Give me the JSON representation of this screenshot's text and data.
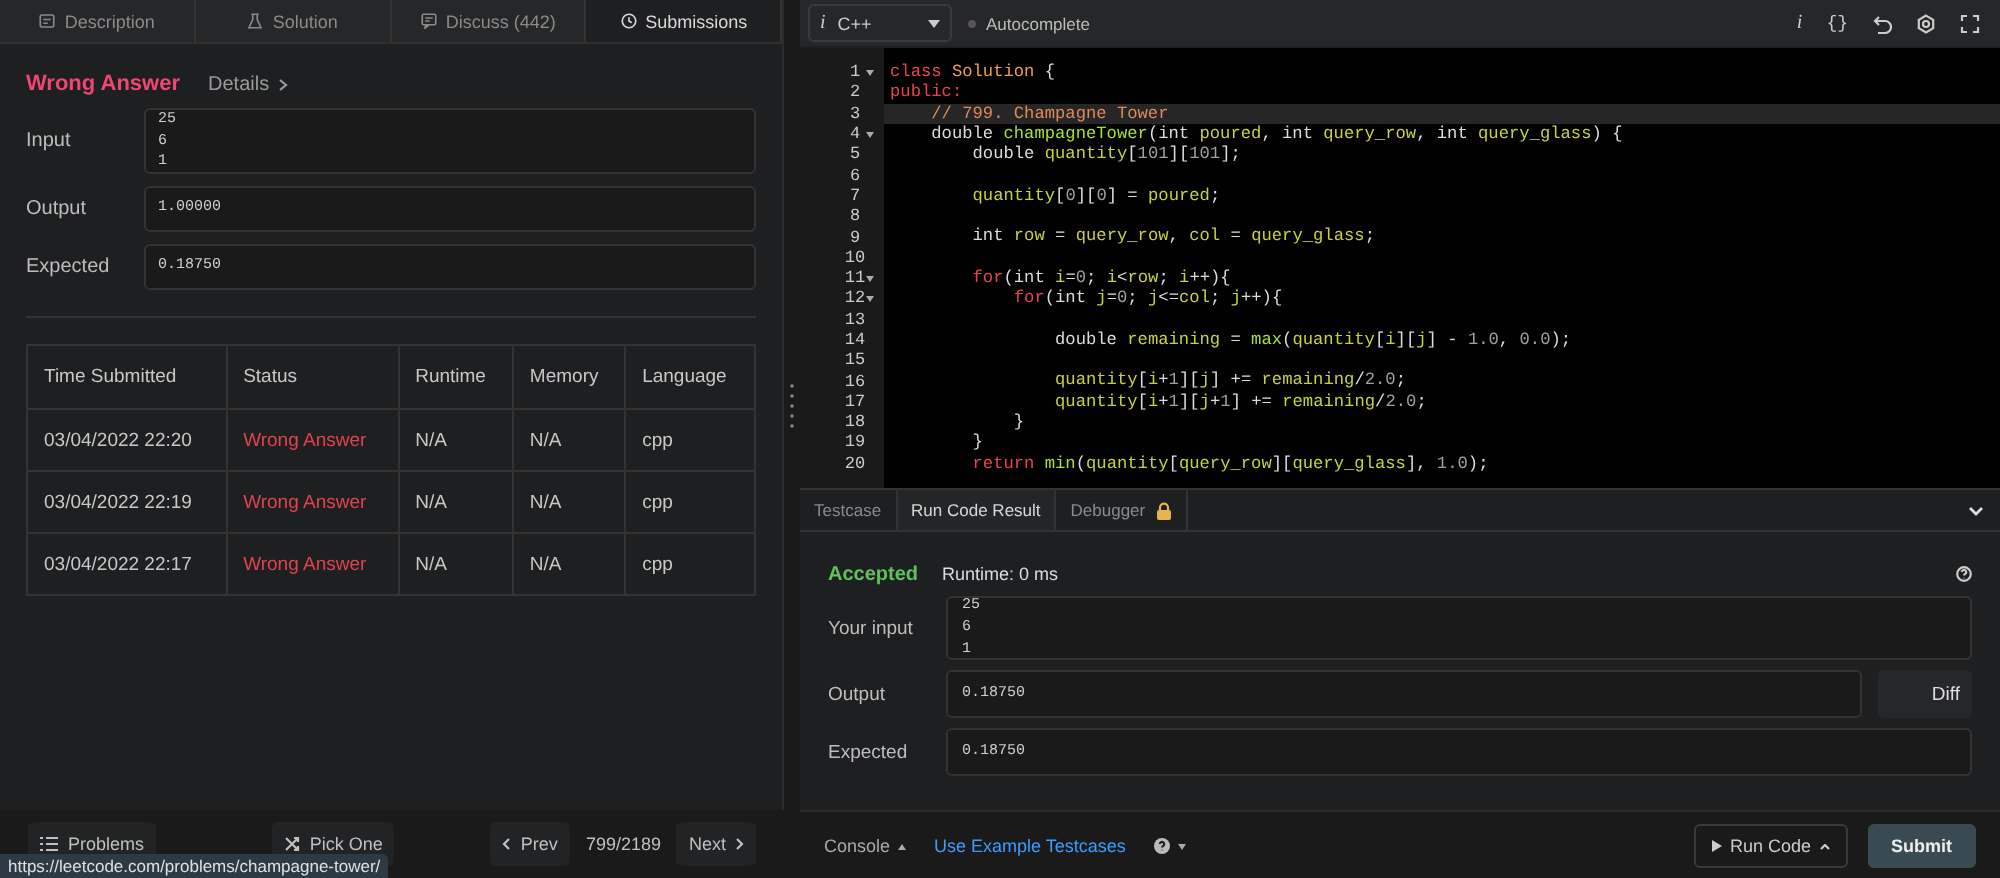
{
  "left_tabs": [
    {
      "label": "Description",
      "selected": false
    },
    {
      "label": "Solution",
      "selected": false
    },
    {
      "label": "Discuss (442)",
      "selected": false
    },
    {
      "label": "Submissions",
      "selected": true
    }
  ],
  "result": {
    "status": "Wrong Answer",
    "details": "Details",
    "fields": [
      {
        "label": "Input",
        "lines": [
          "25",
          "6",
          "1"
        ]
      },
      {
        "label": "Output",
        "lines": [
          "1.00000"
        ]
      },
      {
        "label": "Expected",
        "lines": [
          "0.18750"
        ]
      }
    ]
  },
  "submissions": {
    "columns": [
      "Time Submitted",
      "Status",
      "Runtime",
      "Memory",
      "Language"
    ],
    "rows": [
      {
        "time": "03/04/2022 22:20",
        "status": "Wrong Answer",
        "runtime": "N/A",
        "memory": "N/A",
        "language": "cpp"
      },
      {
        "time": "03/04/2022 22:19",
        "status": "Wrong Answer",
        "runtime": "N/A",
        "memory": "N/A",
        "language": "cpp"
      },
      {
        "time": "03/04/2022 22:17",
        "status": "Wrong Answer",
        "runtime": "N/A",
        "memory": "N/A",
        "language": "cpp"
      }
    ]
  },
  "editor": {
    "info": "i",
    "language": "C++",
    "autocomplete": "Autocomplete",
    "info_button": "i",
    "format": "{}",
    "lines": [
      {
        "number": "1",
        "fold": true,
        "current": false,
        "tokens": [
          {
            "text": "class ",
            "kind": "kw"
          },
          {
            "text": "Solution",
            "kind": "cls"
          },
          {
            "text": " {",
            "kind": "p"
          }
        ]
      },
      {
        "number": "2",
        "fold": false,
        "current": false,
        "tokens": [
          {
            "text": "public:",
            "kind": "kw"
          }
        ]
      },
      {
        "number": "3",
        "fold": false,
        "current": true,
        "tokens": [
          {
            "text": "    // 799. Champagne Tower",
            "kind": "cm"
          }
        ]
      },
      {
        "number": "4",
        "fold": true,
        "current": false,
        "tokens": [
          {
            "text": "    double ",
            "kind": "p"
          },
          {
            "text": "champagneTower",
            "kind": "fn"
          },
          {
            "text": "(int ",
            "kind": "p"
          },
          {
            "text": "poured",
            "kind": "v"
          },
          {
            "text": ", int ",
            "kind": "p"
          },
          {
            "text": "query_row",
            "kind": "v"
          },
          {
            "text": ", int ",
            "kind": "p"
          },
          {
            "text": "query_glass",
            "kind": "v"
          },
          {
            "text": ") {",
            "kind": "p"
          }
        ]
      },
      {
        "number": "5",
        "fold": false,
        "current": false,
        "tokens": [
          {
            "text": "        double ",
            "kind": "p"
          },
          {
            "text": "quantity",
            "kind": "v"
          },
          {
            "text": "[",
            "kind": "p"
          },
          {
            "text": "101",
            "kind": "n"
          },
          {
            "text": "][",
            "kind": "p"
          },
          {
            "text": "101",
            "kind": "n"
          },
          {
            "text": "];",
            "kind": "p"
          }
        ]
      },
      {
        "number": "6",
        "fold": false,
        "current": false
      },
      {
        "number": "7",
        "fold": false,
        "current": false,
        "tokens": [
          {
            "text": "        quantity",
            "kind": "v"
          },
          {
            "text": "[",
            "kind": "p"
          },
          {
            "text": "0",
            "kind": "n"
          },
          {
            "text": "][",
            "kind": "p"
          },
          {
            "text": "0",
            "kind": "n"
          },
          {
            "text": "] = ",
            "kind": "p"
          },
          {
            "text": "poured",
            "kind": "v"
          },
          {
            "text": ";",
            "kind": "p"
          }
        ]
      },
      {
        "number": "8",
        "fold": false,
        "current": false
      },
      {
        "number": "9",
        "fold": false,
        "current": false,
        "tokens": [
          {
            "text": "        int ",
            "kind": "p"
          },
          {
            "text": "row",
            "kind": "v"
          },
          {
            "text": " = ",
            "kind": "p"
          },
          {
            "text": "query_row",
            "kind": "v"
          },
          {
            "text": ", ",
            "kind": "p"
          },
          {
            "text": "col",
            "kind": "v"
          },
          {
            "text": " = ",
            "kind": "p"
          },
          {
            "text": "query_glass",
            "kind": "v"
          },
          {
            "text": ";",
            "kind": "p"
          }
        ]
      },
      {
        "number": "10",
        "fold": false,
        "current": false
      },
      {
        "number": "11",
        "fold": true,
        "current": false,
        "tokens": [
          {
            "text": "        for",
            "kind": "kw"
          },
          {
            "text": "(int ",
            "kind": "p"
          },
          {
            "text": "i",
            "kind": "v"
          },
          {
            "text": "=",
            "kind": "p"
          },
          {
            "text": "0",
            "kind": "n"
          },
          {
            "text": "; ",
            "kind": "p"
          },
          {
            "text": "i",
            "kind": "v"
          },
          {
            "text": "<",
            "kind": "p"
          },
          {
            "text": "row",
            "kind": "v"
          },
          {
            "text": "; ",
            "kind": "p"
          },
          {
            "text": "i",
            "kind": "v"
          },
          {
            "text": "++){",
            "kind": "p"
          }
        ]
      },
      {
        "number": "12",
        "fold": true,
        "current": false,
        "tokens": [
          {
            "text": "            for",
            "kind": "kw"
          },
          {
            "text": "(int ",
            "kind": "p"
          },
          {
            "text": "j",
            "kind": "v"
          },
          {
            "text": "=",
            "kind": "p"
          },
          {
            "text": "0",
            "kind": "n"
          },
          {
            "text": "; ",
            "kind": "p"
          },
          {
            "text": "j",
            "kind": "v"
          },
          {
            "text": "<=",
            "kind": "p"
          },
          {
            "text": "col",
            "kind": "v"
          },
          {
            "text": "; ",
            "kind": "p"
          },
          {
            "text": "j",
            "kind": "v"
          },
          {
            "text": "++){",
            "kind": "p"
          }
        ]
      },
      {
        "number": "13",
        "fold": false,
        "current": false
      },
      {
        "number": "14",
        "fold": false,
        "current": false,
        "tokens": [
          {
            "text": "                double ",
            "kind": "p"
          },
          {
            "text": "remaining",
            "kind": "v"
          },
          {
            "text": " = ",
            "kind": "p"
          },
          {
            "text": "max",
            "kind": "fn"
          },
          {
            "text": "(",
            "kind": "p"
          },
          {
            "text": "quantity",
            "kind": "v"
          },
          {
            "text": "[",
            "kind": "p"
          },
          {
            "text": "i",
            "kind": "v"
          },
          {
            "text": "][",
            "kind": "p"
          },
          {
            "text": "j",
            "kind": "v"
          },
          {
            "text": "] - ",
            "kind": "p"
          },
          {
            "text": "1.0",
            "kind": "n"
          },
          {
            "text": ", ",
            "kind": "p"
          },
          {
            "text": "0.0",
            "kind": "n"
          },
          {
            "text": ");",
            "kind": "p"
          }
        ]
      },
      {
        "number": "15",
        "fold": false,
        "current": false
      },
      {
        "number": "16",
        "fold": false,
        "current": false,
        "tokens": [
          {
            "text": "                quantity",
            "kind": "v"
          },
          {
            "text": "[",
            "kind": "p"
          },
          {
            "text": "i",
            "kind": "v"
          },
          {
            "text": "+",
            "kind": "p"
          },
          {
            "text": "1",
            "kind": "n"
          },
          {
            "text": "][",
            "kind": "p"
          },
          {
            "text": "j",
            "kind": "v"
          },
          {
            "text": "] += ",
            "kind": "p"
          },
          {
            "text": "remaining",
            "kind": "v"
          },
          {
            "text": "/",
            "kind": "p"
          },
          {
            "text": "2.0",
            "kind": "n"
          },
          {
            "text": ";",
            "kind": "p"
          }
        ]
      },
      {
        "number": "17",
        "fold": false,
        "current": false,
        "tokens": [
          {
            "text": "                quantity",
            "kind": "v"
          },
          {
            "text": "[",
            "kind": "p"
          },
          {
            "text": "i",
            "kind": "v"
          },
          {
            "text": "+",
            "kind": "p"
          },
          {
            "text": "1",
            "kind": "n"
          },
          {
            "text": "][",
            "kind": "p"
          },
          {
            "text": "j",
            "kind": "v"
          },
          {
            "text": "+",
            "kind": "p"
          },
          {
            "text": "1",
            "kind": "n"
          },
          {
            "text": "] += ",
            "kind": "p"
          },
          {
            "text": "remaining",
            "kind": "v"
          },
          {
            "text": "/",
            "kind": "p"
          },
          {
            "text": "2.0",
            "kind": "n"
          },
          {
            "text": ";",
            "kind": "p"
          }
        ]
      },
      {
        "number": "18",
        "fold": false,
        "current": false,
        "tokens": [
          {
            "text": "            }",
            "kind": "p"
          }
        ]
      },
      {
        "number": "19",
        "fold": false,
        "current": false,
        "tokens": [
          {
            "text": "        }",
            "kind": "p"
          }
        ]
      },
      {
        "number": "20",
        "fold": false,
        "current": false,
        "tokens": [
          {
            "text": "        return",
            "kind": "kw"
          },
          {
            "text": " min",
            "kind": "fn"
          },
          {
            "text": "(",
            "kind": "p"
          },
          {
            "text": "quantity",
            "kind": "v"
          },
          {
            "text": "[",
            "kind": "p"
          },
          {
            "text": "query_row",
            "kind": "v"
          },
          {
            "text": "][",
            "kind": "p"
          },
          {
            "text": "query_glass",
            "kind": "v"
          },
          {
            "text": "], ",
            "kind": "p"
          },
          {
            "text": "1.0",
            "kind": "n"
          },
          {
            "text": ");",
            "kind": "p"
          }
        ]
      }
    ]
  },
  "console": {
    "tabs": [
      {
        "label": "Testcase",
        "selected": false,
        "locked": false
      },
      {
        "label": "Run Code Result",
        "selected": true,
        "locked": false
      },
      {
        "label": "Debugger",
        "selected": false,
        "locked": true
      }
    ],
    "status": "Accepted",
    "runtime": "Runtime: 0 ms",
    "fields": [
      {
        "label": "Your input",
        "lines": [
          "25",
          "6",
          "1"
        ]
      },
      {
        "label": "Output",
        "lines": [
          "0.18750"
        ],
        "diff": "Diff"
      },
      {
        "label": "Expected",
        "lines": [
          "0.18750"
        ]
      }
    ]
  },
  "footer": {
    "problems": "Problems",
    "pick": "Pick One",
    "prev": "Prev",
    "counter": "799/2189",
    "next": "Next",
    "console": "Console",
    "example": "Use Example Testcases",
    "run": "Run Code",
    "submit": "Submit"
  },
  "status_url": "https://leetcode.com/problems/champagne-tower/"
}
